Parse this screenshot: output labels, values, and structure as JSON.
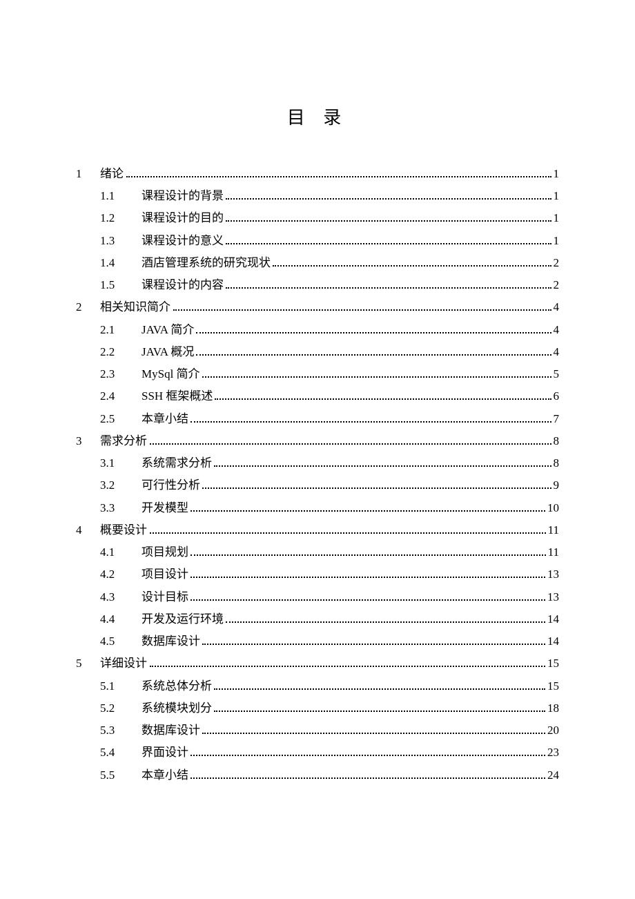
{
  "title": "目 录",
  "entries": [
    {
      "level": 1,
      "num": "1",
      "text": "绪论",
      "page": "1"
    },
    {
      "level": 2,
      "num": "1.1",
      "text": "课程设计的背景",
      "page": "1"
    },
    {
      "level": 2,
      "num": "1.2",
      "text": "课程设计的目的",
      "page": "1"
    },
    {
      "level": 2,
      "num": "1.3",
      "text": "课程设计的意义",
      "page": "1"
    },
    {
      "level": 2,
      "num": "1.4",
      "text": "酒店管理系统的研究现状",
      "page": "2"
    },
    {
      "level": 2,
      "num": "1.5",
      "text": "课程设计的内容",
      "page": "2"
    },
    {
      "level": 1,
      "num": "2",
      "text": "相关知识简介",
      "page": "4"
    },
    {
      "level": 2,
      "num": "2.1",
      "text": "JAVA 简介",
      "page": "4"
    },
    {
      "level": 2,
      "num": "2.2",
      "text": "JAVA 概况",
      "page": "4"
    },
    {
      "level": 2,
      "num": "2.3",
      "text": "MySql 简介",
      "page": "5"
    },
    {
      "level": 2,
      "num": "2.4",
      "text": "SSH 框架概述",
      "page": "6"
    },
    {
      "level": 2,
      "num": "2.5",
      "text": "本章小结",
      "page": "7"
    },
    {
      "level": 1,
      "num": "3",
      "text": "需求分析",
      "page": "8"
    },
    {
      "level": 2,
      "num": "3.1",
      "text": "系统需求分析",
      "page": "8"
    },
    {
      "level": 2,
      "num": "3.2",
      "text": "可行性分析",
      "page": "9"
    },
    {
      "level": 2,
      "num": "3.3",
      "text": "开发模型",
      "page": "10"
    },
    {
      "level": 1,
      "num": "4",
      "text": "概要设计",
      "page": "11"
    },
    {
      "level": 2,
      "num": "4.1",
      "text": "项目规划",
      "page": "11"
    },
    {
      "level": 2,
      "num": "4.2",
      "text": "项目设计",
      "page": "13"
    },
    {
      "level": 2,
      "num": "4.3",
      "text": "设计目标",
      "page": "13"
    },
    {
      "level": 2,
      "num": "4.4",
      "text": "开发及运行环境",
      "page": "14"
    },
    {
      "level": 2,
      "num": "4.5",
      "text": "数据库设计",
      "page": "14"
    },
    {
      "level": 1,
      "num": "5",
      "text": "详细设计",
      "page": "15"
    },
    {
      "level": 2,
      "num": "5.1",
      "text": "系统总体分析",
      "page": "15"
    },
    {
      "level": 2,
      "num": "5.2",
      "text": "系统模块划分",
      "page": "18"
    },
    {
      "level": 2,
      "num": "5.3",
      "text": "数据库设计",
      "page": "20"
    },
    {
      "level": 2,
      "num": "5.4",
      "text": "界面设计",
      "page": "23"
    },
    {
      "level": 2,
      "num": "5.5",
      "text": "本章小结",
      "page": "24"
    }
  ]
}
